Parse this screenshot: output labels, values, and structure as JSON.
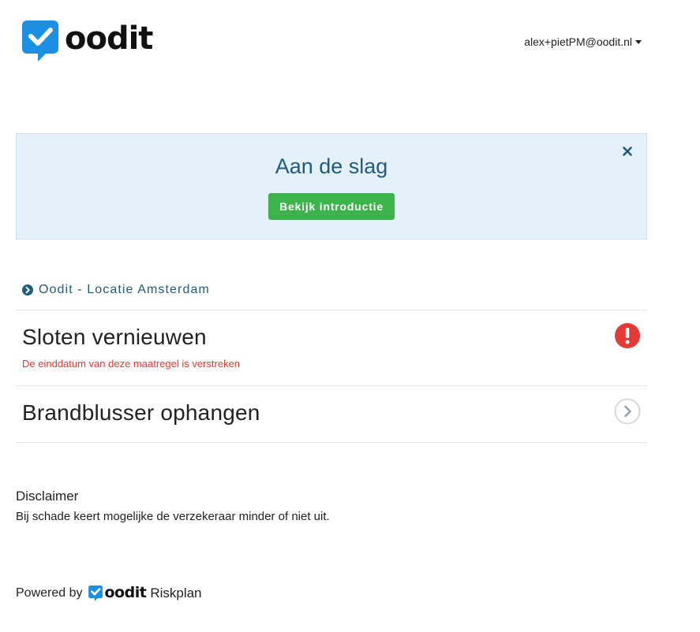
{
  "header": {
    "logo_text": "oodit",
    "user_email": "alex+pietPM@oodit.nl"
  },
  "intro": {
    "title": "Aan de slag",
    "button_label": "Bekijk introductie"
  },
  "location": {
    "label": "Oodit - Locatie Amsterdam"
  },
  "tasks": [
    {
      "title": "Sloten vernieuwen",
      "warning": "De einddatum van deze maatregel is verstreken",
      "status_icon": "exclamation-circle-icon"
    },
    {
      "title": "Brandblusser ophangen",
      "status_icon": "chevron-right-circle-icon"
    }
  ],
  "disclaimer": {
    "title": "Disclaimer",
    "text": "Bij schade keert mogelijke de verzekeraar minder of niet uit."
  },
  "footer": {
    "powered_by": "Powered by",
    "brand": "oodit",
    "product": "Riskplan"
  },
  "colors": {
    "brand_blue": "#1a8fe3",
    "accent_navy": "#1f5b82",
    "success_green": "#3bb54a",
    "danger_red": "#e53935",
    "panel_bg": "#e5f1f9"
  }
}
